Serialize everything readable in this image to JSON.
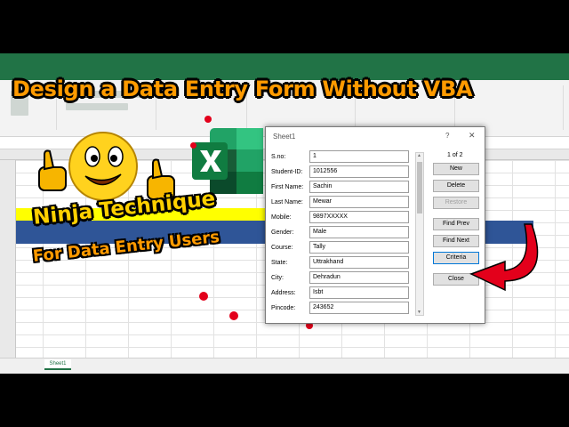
{
  "headline": "Design a Data Entry Form Without VBA",
  "subtitle_line1": "Ninja Technique",
  "subtitle_line2": "For Data Entry Users",
  "excel": {
    "sheet_tab": "Sheet1"
  },
  "dialog": {
    "title": "Sheet1",
    "help": "?",
    "close": "✕",
    "record_count": "1 of 2",
    "fields": [
      {
        "label": "S.no:",
        "value": "1"
      },
      {
        "label": "Student-ID:",
        "value": "1012556"
      },
      {
        "label": "First Name:",
        "value": "Sachin"
      },
      {
        "label": "Last Name:",
        "value": "Mewar"
      },
      {
        "label": "Mobile:",
        "value": "9897XXXXX"
      },
      {
        "label": "Gender:",
        "value": "Male"
      },
      {
        "label": "Course:",
        "value": "Tally"
      },
      {
        "label": "State:",
        "value": "Uttrakhand"
      },
      {
        "label": "City:",
        "value": "Dehradun"
      },
      {
        "label": "Address:",
        "value": "Isbt"
      },
      {
        "label": "Pincode:",
        "value": "243652"
      }
    ],
    "buttons": {
      "new": "New",
      "delete": "Delete",
      "restore": "Restore",
      "find_prev": "Find Prev",
      "find_next": "Find Next",
      "criteria": "Criteria",
      "close": "Close"
    }
  },
  "colors": {
    "excel_green": "#217346",
    "headline_orange": "#ff9a00",
    "subtitle_yellow": "#ffd000",
    "accent_red": "#e3001b",
    "sheet_yellow": "#ffff00",
    "sheet_header_blue": "#2f5597"
  },
  "icons": [
    "smiley-thumbs-up-icon",
    "excel-logo-icon",
    "red-curved-arrow-icon"
  ]
}
